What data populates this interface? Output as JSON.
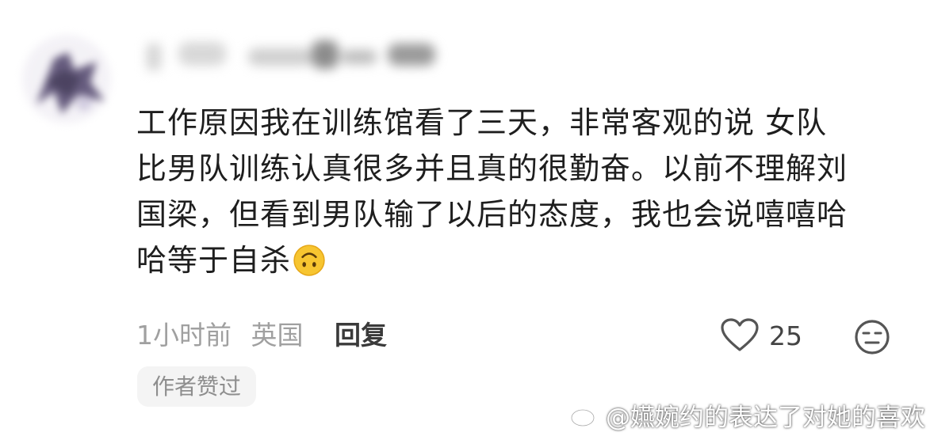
{
  "comment": {
    "line1": "工作原因我在训练馆看了三天，非常客观的说 女队",
    "line2": "比男队训练认真很多并且真的很勤奋。以前不理解刘",
    "line3": "国梁，但看到男队输了以后的态度，我也会说嘻嘻哈",
    "line4": "哈等于自杀",
    "emoji": "upside-down-face-emoji"
  },
  "meta": {
    "time": "1小时前",
    "location": "英国",
    "reply_label": "回复"
  },
  "like": {
    "icon": "heart-icon",
    "count": "25"
  },
  "dislike": {
    "icon": "unamused-face-icon"
  },
  "badge": {
    "author_liked": "作者赞过"
  },
  "watermark": {
    "text": "@嬿婉约的表达了对她的喜欢",
    "icon": "weibo-logo-icon"
  },
  "colors": {
    "text": "#1e1e1e",
    "meta": "#a0a0a0",
    "badge_bg": "#f4f4f4",
    "emoji_yellow": "#f7c530"
  }
}
